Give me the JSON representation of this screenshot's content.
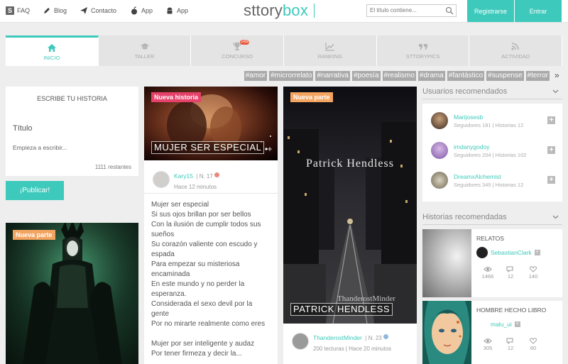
{
  "header": {
    "links": [
      {
        "label": "FAQ",
        "icon": "faq-icon"
      },
      {
        "label": "Blog",
        "icon": "pen-icon"
      },
      {
        "label": "Contacto",
        "icon": "paper-plane-icon"
      },
      {
        "label": "App",
        "icon": "apple-icon"
      },
      {
        "label": "App",
        "icon": "android-icon"
      }
    ],
    "logo_left": "sttory",
    "logo_right": "box",
    "search_placeholder": "El título contiene...",
    "register_label": "Registrarse",
    "login_label": "Entrar",
    "accent_color": "#3dc9bb"
  },
  "tabs": [
    {
      "label": "INICIO",
      "icon": "home-icon",
      "active": true
    },
    {
      "label": "TALLER",
      "icon": "graduation-cap-icon",
      "active": false
    },
    {
      "label": "CONCURSO",
      "icon": "trophy-icon",
      "active": false,
      "badge": "1430"
    },
    {
      "label": "RANKING",
      "icon": "line-chart-icon",
      "active": false
    },
    {
      "label": "STTORYPICS",
      "icon": "quote-icon",
      "active": false
    },
    {
      "label": "ACTIVIDAD",
      "icon": "rss-icon",
      "active": false
    }
  ],
  "hashtags": [
    "#amor",
    "#microrrelato",
    "#narrativa",
    "#poesía",
    "#realismo",
    "#drama",
    "#fantástico",
    "#suspense",
    "#terror"
  ],
  "write_box": {
    "heading": "ESCRIBE TU HISTORIA",
    "title_placeholder": "Título",
    "body_placeholder": "Empieza a escribir...",
    "remaining": "1111 restantes",
    "publish_label": "¡Publicar!"
  },
  "feed": {
    "hela_card": {
      "label": "Nueva parte"
    },
    "mujer_card": {
      "label": "Nueva historia",
      "image_title": "MUJER SER ESPECIAL",
      "author": "Kary15",
      "level": "| N. 17",
      "time": "Hace 12 minutos",
      "lines": [
        "Mujer ser especial",
        "Si sus ojos brillan por ser bellos",
        "Con la ilusión de cumplir todos sus",
        "sueños",
        "Su corazón valiente con escudo y",
        "espada",
        "Para empezar su misteriosa",
        "encaminada",
        "En este mundo y no perder la",
        "esperanza.",
        "Considerada el sexo devil por la",
        "gente",
        "Por no mirarte realmente como eres",
        "",
        "Mujer por ser inteligente y audaz",
        "Por tener firmeza y decir la..."
      ]
    },
    "patrick_card": {
      "label": "Nueva parte",
      "cover_title": "Patrick Hendless",
      "cover_signature": "ThanderostMinder",
      "image_title": "PATRICK HENDLESS",
      "author": "ThanderostMinder",
      "level": "| N. 23",
      "meta": "200 lecturas | Hace 20 minutos"
    }
  },
  "recommended_users": {
    "heading": "Usuarios recomendados",
    "users": [
      {
        "name": "Marijosesb",
        "meta": "Seguidores 181 | Historias 12"
      },
      {
        "name": "imdanygodoy",
        "meta": "Seguidores 204 | Historias 102"
      },
      {
        "name": "DreamxAlchemist",
        "meta": "Seguidores 345 | Historias 12"
      }
    ]
  },
  "recommended_stories": {
    "heading": "Historias recomendadas",
    "stories": [
      {
        "title": "RELATOS",
        "author": "SebastianClark",
        "views": "1466",
        "comments": "12",
        "likes": "140"
      },
      {
        "title": "HOMBRE HECHO LIBRO",
        "author": "malu_ui",
        "views": "305",
        "comments": "12",
        "likes": "60"
      }
    ]
  }
}
